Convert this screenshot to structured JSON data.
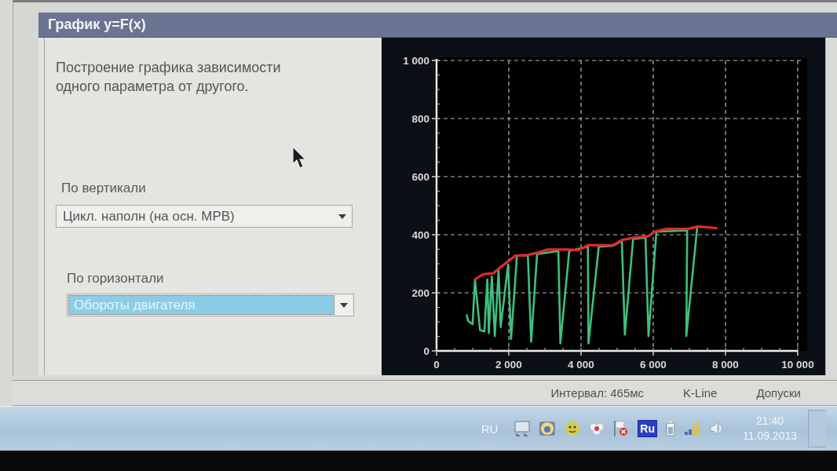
{
  "panel": {
    "title": "График y=F(x)",
    "description": "Построение графика зависимости одного параметра от другого."
  },
  "selectors": [
    {
      "label": "По вертикали",
      "value": "Цикл. наполн (на осн. МРВ)",
      "focused": false
    },
    {
      "label": "По горизонтали",
      "value": "Обороты двигателя",
      "focused": true
    }
  ],
  "chart": {
    "chart_data": {
      "type": "line",
      "grid": true,
      "xlim": [
        0,
        10000
      ],
      "ylim": [
        0,
        1000
      ],
      "xticks": [
        {
          "value": 0,
          "label": "0"
        },
        {
          "value": 2000,
          "label": "2 000"
        },
        {
          "value": 4000,
          "label": "4 000"
        },
        {
          "value": 6000,
          "label": "6 000"
        },
        {
          "value": 8000,
          "label": "8 000"
        },
        {
          "value": 10000,
          "label": "10 000"
        }
      ],
      "yticks": [
        {
          "value": 0,
          "label": "0"
        },
        {
          "value": 200,
          "label": "200"
        },
        {
          "value": 400,
          "label": "400"
        },
        {
          "value": 600,
          "label": "600"
        },
        {
          "value": 800,
          "label": "800"
        },
        {
          "value": 1000,
          "label": "1 000"
        }
      ],
      "series": [
        {
          "color": "#3fbf7c",
          "x": [
            835,
            876,
            998,
            1064,
            1203,
            1325,
            1407,
            1448,
            1530,
            1612,
            1718,
            1776,
            1980,
            2062,
            2226,
            2529,
            2619,
            2782,
            3371,
            3429,
            3674,
            4190,
            4206,
            4492,
            4890,
            5131,
            5213,
            5442,
            5785,
            5867,
            6088,
            6940,
            6915,
            7218
          ],
          "values": [
            123,
            103,
            92,
            246,
            72,
            67,
            246,
            62,
            256,
            51,
            277,
            82,
            297,
            41,
            328,
            328,
            31,
            333,
            344,
            26,
            344,
            359,
            26,
            359,
            362,
            379,
            56,
            385,
            390,
            51,
            410,
            415,
            51,
            426
          ]
        },
        {
          "color": "#e02a2a",
          "x": [
            1060,
            1290,
            1570,
            1740,
            1980,
            2190,
            2510,
            2800,
            3090,
            3620,
            3940,
            4190,
            4890,
            5130,
            5500,
            5870,
            6030,
            6360,
            6970,
            7220,
            7460,
            7750
          ],
          "values": [
            246,
            264,
            267,
            285,
            308,
            328,
            330,
            338,
            349,
            349,
            347,
            364,
            364,
            382,
            390,
            395,
            410,
            420,
            420,
            428,
            426,
            423
          ]
        }
      ]
    }
  },
  "status_bar": {
    "items": [
      "Интервал: 465мс",
      "K-Line",
      "Допуски"
    ]
  },
  "taskbar": {
    "language": "RU",
    "input_badge": "Ru",
    "time": "21:40",
    "date": "11.09.2013"
  }
}
